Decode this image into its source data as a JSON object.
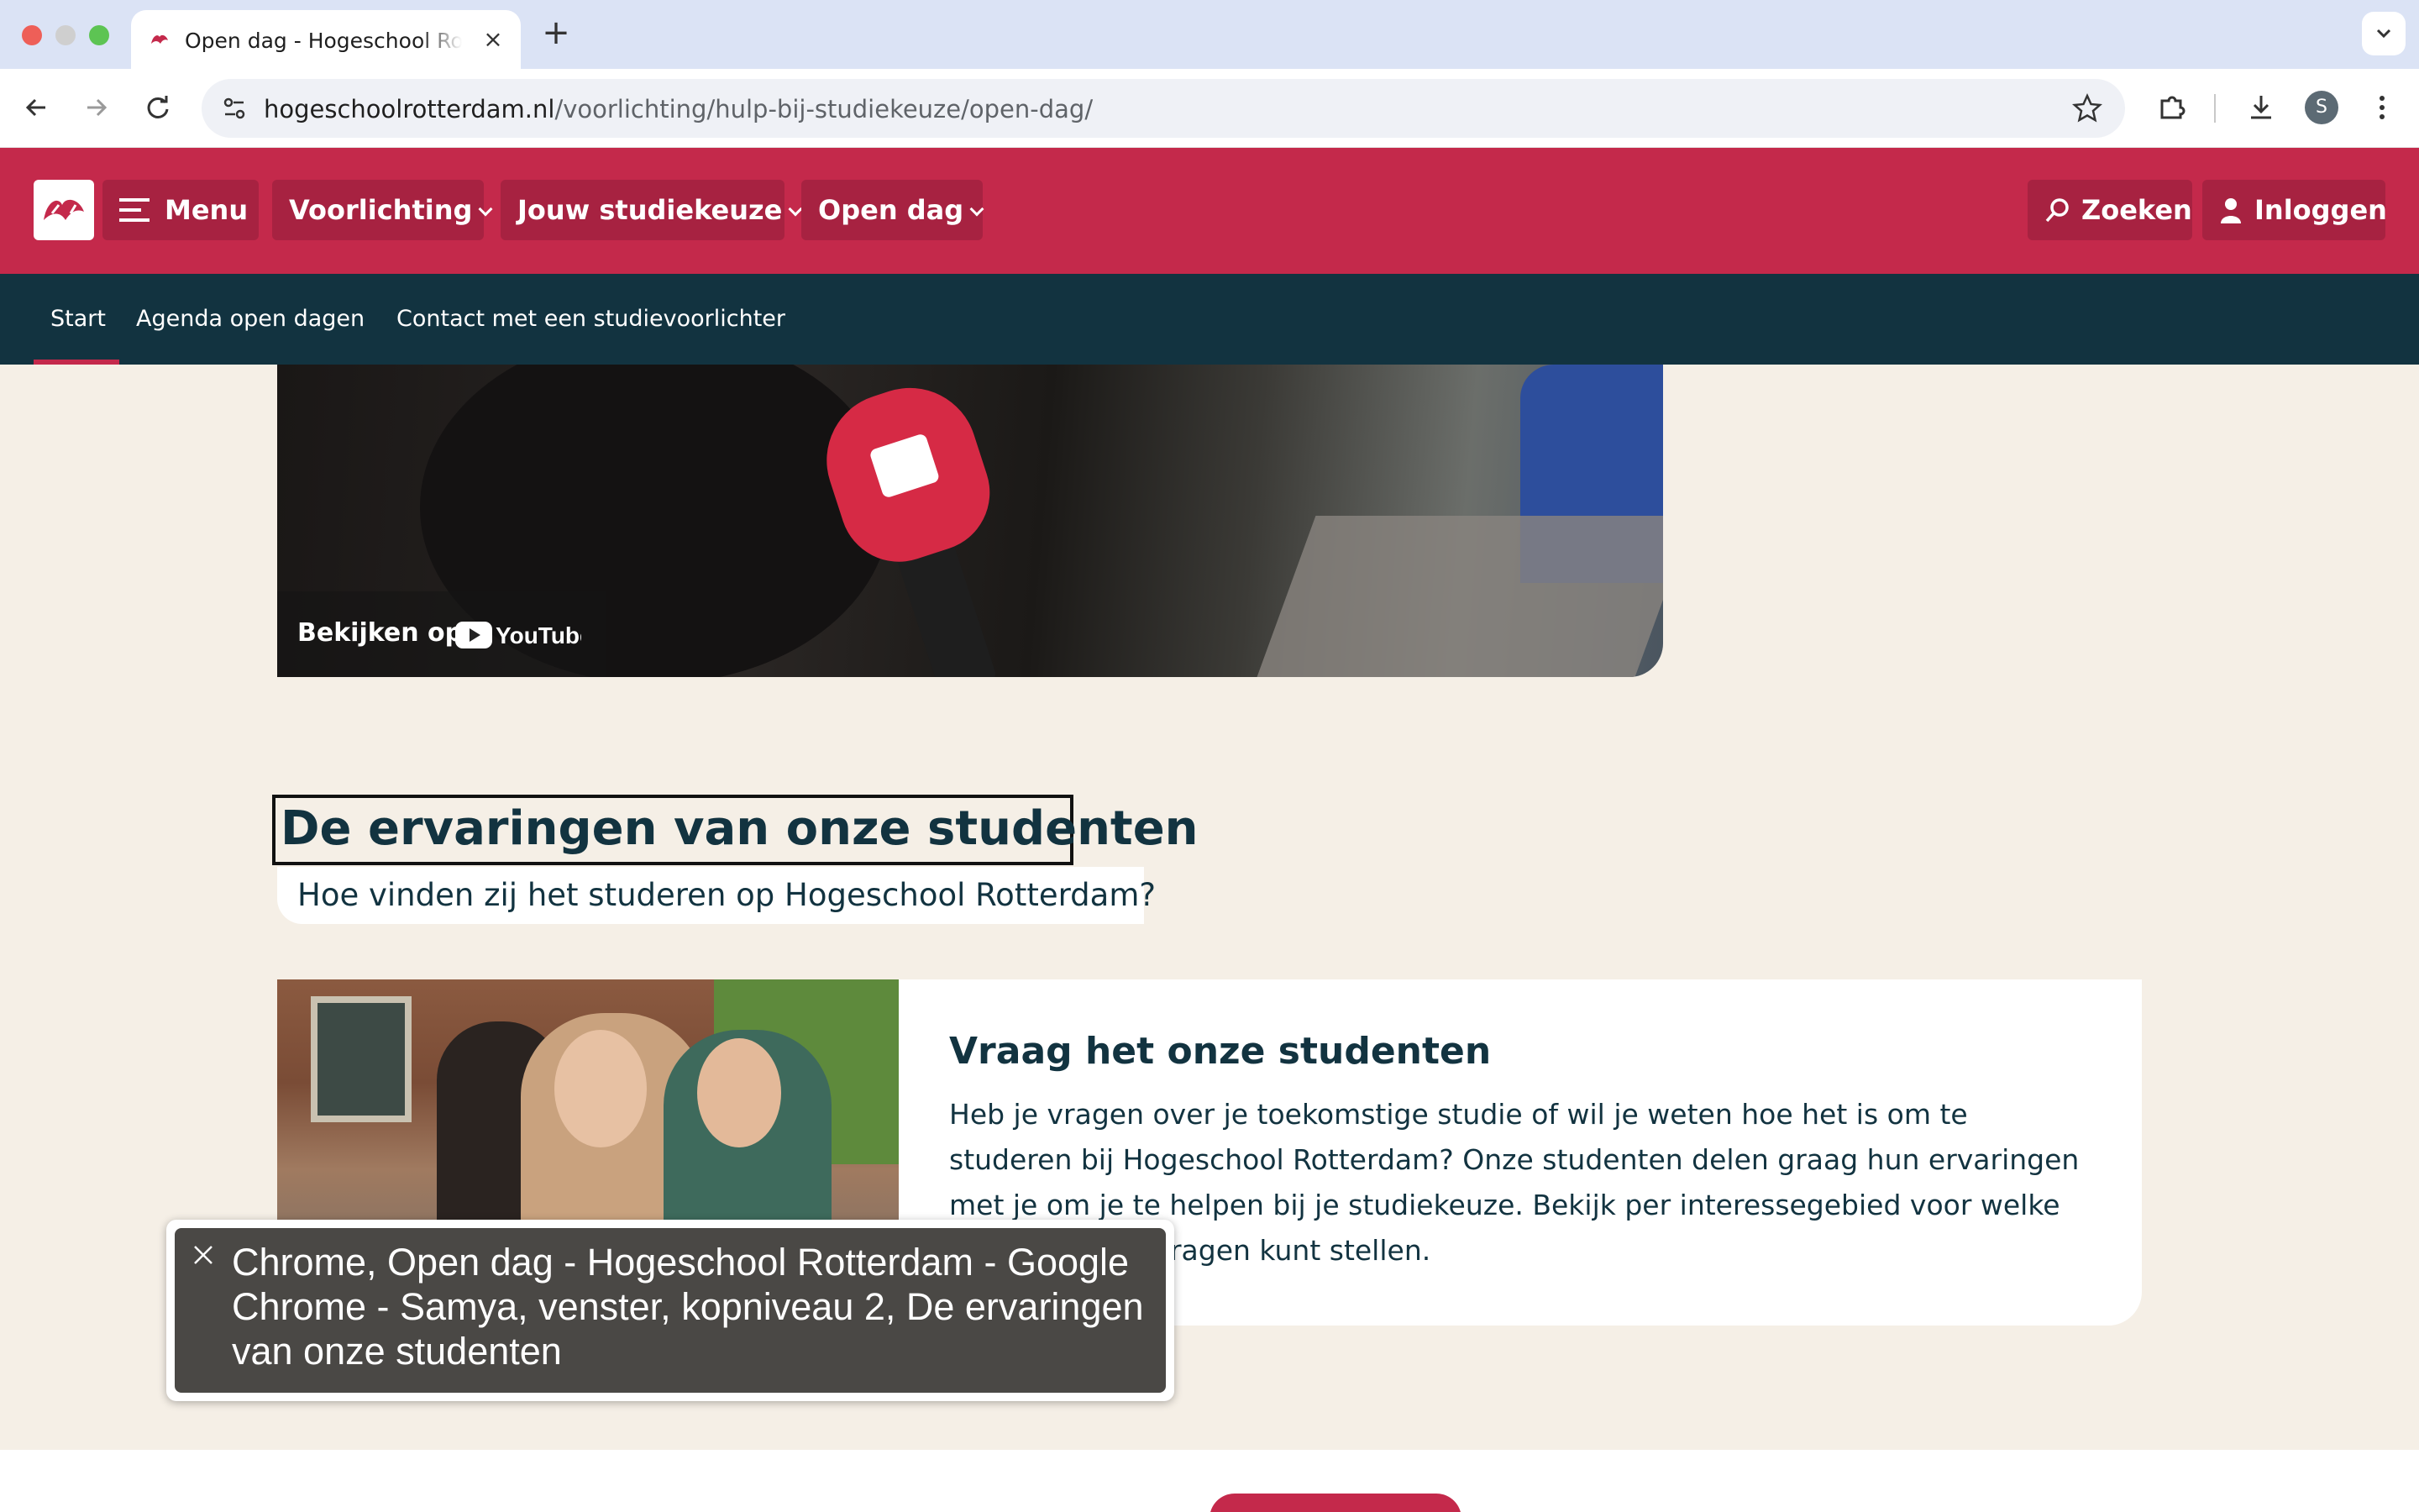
{
  "browser": {
    "tab_title": "Open dag - Hogeschool Rotterdam",
    "url_host": "hogeschoolrotterdam.nl",
    "url_path": "/voorlichting/hulp-bij-studiekeuze/open-dag/",
    "profile_initial": "S"
  },
  "header": {
    "menu_label": "Menu",
    "nav": [
      {
        "label": "Voorlichting"
      },
      {
        "label": "Jouw studiekeuze"
      },
      {
        "label": "Open dag"
      }
    ],
    "search_label": "Zoeken",
    "login_label": "Inloggen",
    "brand_color": "#c4294b"
  },
  "subnav": {
    "items": [
      {
        "label": "Start",
        "active": true
      },
      {
        "label": "Agenda open dagen"
      },
      {
        "label": "Contact met een studievoorlichter"
      }
    ]
  },
  "video": {
    "watch_on_label": "Bekijken op",
    "platform": "YouTube"
  },
  "section": {
    "title": "De ervaringen van onze studenten",
    "subtitle": "Hoe vinden zij het studeren op Hogeschool Rotterdam?"
  },
  "card": {
    "title": "Vraag het onze studenten",
    "body": "Heb je vragen over je toekomstige studie of wil je weten hoe het is om te studeren bij Hogeschool Rotterdam? Onze studenten delen graag hun ervaringen met je om je te helpen bij je studiekeuze. Bekijk per interessegebied voor welke opleidingen je vragen kunt stellen."
  },
  "accessibility_popup": {
    "text": "Chrome, Open dag - Hogeschool Rotterdam - Google Chrome - Samya, venster, kopniveau 2, De ervaringen van onze studenten"
  }
}
